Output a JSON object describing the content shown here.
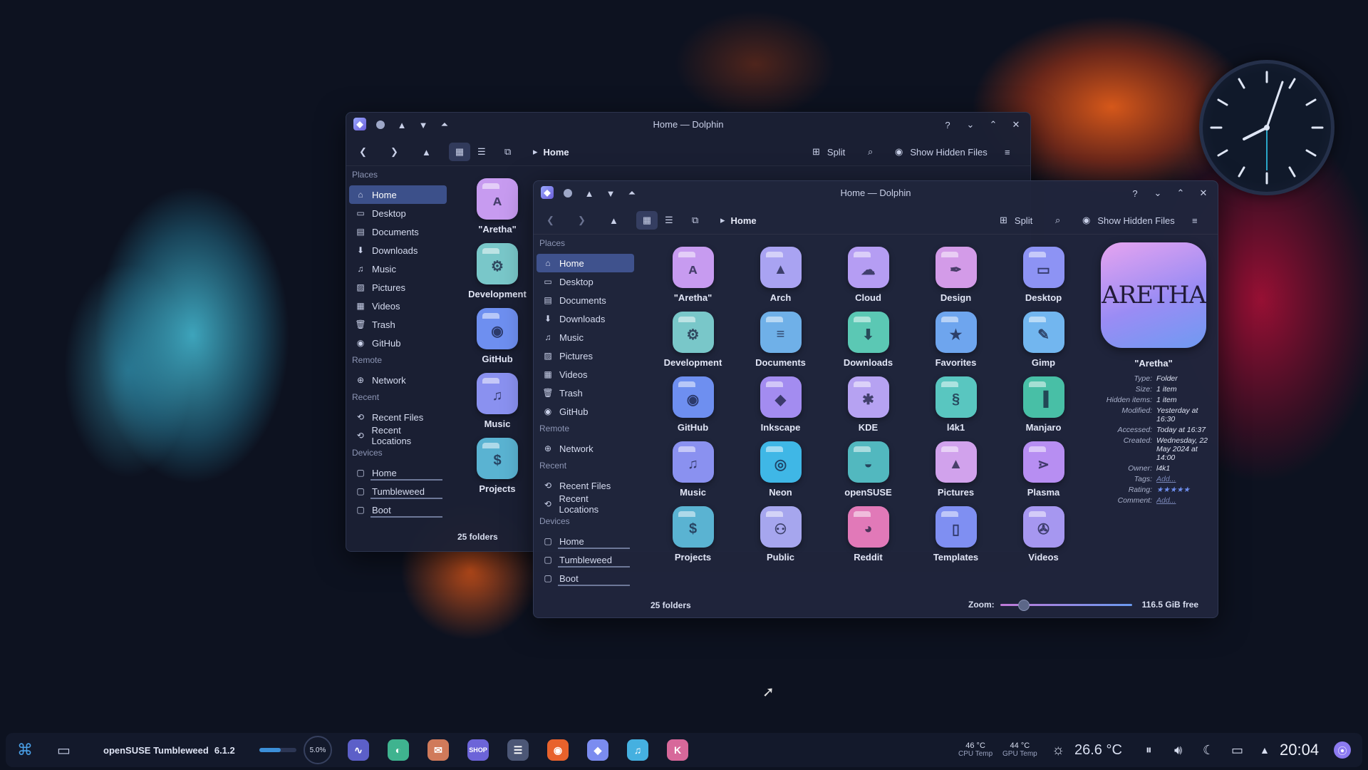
{
  "window_back": {
    "title": "Home — Dolphin",
    "breadcrumb": "Home",
    "split_label": "Split",
    "hidden_label": "Show Hidden Files",
    "status": "25 folders",
    "places_header": "Places",
    "places": [
      "Home",
      "Desktop",
      "Documents",
      "Downloads",
      "Music",
      "Pictures",
      "Videos",
      "Trash",
      "GitHub"
    ],
    "remote_header": "Remote",
    "remote": [
      "Network"
    ],
    "recent_header": "Recent",
    "recent": [
      "Recent Files",
      "Recent Locations"
    ],
    "devices_header": "Devices",
    "devices": [
      "Home",
      "Tumbleweed",
      "Boot"
    ],
    "folders": [
      "\"Aretha\"",
      "Development",
      "GitHub",
      "Music",
      "Projects"
    ]
  },
  "window_front": {
    "title": "Home — Dolphin",
    "breadcrumb": "Home",
    "split_label": "Split",
    "hidden_label": "Show Hidden Files",
    "places_header": "Places",
    "places": [
      "Home",
      "Desktop",
      "Documents",
      "Downloads",
      "Music",
      "Pictures",
      "Videos",
      "Trash",
      "GitHub"
    ],
    "remote_header": "Remote",
    "remote": [
      "Network"
    ],
    "recent_header": "Recent",
    "recent": [
      "Recent Files",
      "Recent Locations"
    ],
    "devices_header": "Devices",
    "devices": [
      "Home",
      "Tumbleweed",
      "Boot"
    ],
    "folders": [
      {
        "name": "\"Aretha\"",
        "icon": "aretha-logo",
        "symbol": "ᴀ",
        "color": "#c79bf0"
      },
      {
        "name": "Arch",
        "icon": "arch-icon",
        "symbol": "▲",
        "color": "#a9a3f2"
      },
      {
        "name": "Cloud",
        "icon": "cloud-icon",
        "symbol": "☁",
        "color": "#b59df3"
      },
      {
        "name": "Design",
        "icon": "pen-icon",
        "symbol": "✒",
        "color": "#d39be8"
      },
      {
        "name": "Desktop",
        "icon": "monitor-icon",
        "symbol": "▭",
        "color": "#8d93f4"
      },
      {
        "name": "Development",
        "icon": "gear-icon",
        "symbol": "⚙",
        "color": "#79c7c9"
      },
      {
        "name": "Documents",
        "icon": "document-icon",
        "symbol": "≡",
        "color": "#6fb0e8"
      },
      {
        "name": "Downloads",
        "icon": "download-icon",
        "symbol": "⬇",
        "color": "#5bc8b4"
      },
      {
        "name": "Favorites",
        "icon": "star-icon",
        "symbol": "★",
        "color": "#6ea5ee"
      },
      {
        "name": "Gimp",
        "icon": "gimp-icon",
        "symbol": "✎",
        "color": "#72b6ef"
      },
      {
        "name": "GitHub",
        "icon": "github-icon",
        "symbol": "◉",
        "color": "#6e8ff0"
      },
      {
        "name": "Inkscape",
        "icon": "inkscape-icon",
        "symbol": "◆",
        "color": "#a38cf0"
      },
      {
        "name": "KDE",
        "icon": "kde-icon",
        "symbol": "✱",
        "color": "#b6a2f2"
      },
      {
        "name": "l4k1",
        "icon": "dragon-icon",
        "symbol": "§",
        "color": "#59c6c0"
      },
      {
        "name": "Manjaro",
        "icon": "manjaro-icon",
        "symbol": "▐",
        "color": "#48bfa6"
      },
      {
        "name": "Music",
        "icon": "headphones-icon",
        "symbol": "♫",
        "color": "#8a91f0"
      },
      {
        "name": "Neon",
        "icon": "neon-icon",
        "symbol": "◎",
        "color": "#3fb7e6"
      },
      {
        "name": "openSUSE",
        "icon": "opensuse-icon",
        "symbol": "◒",
        "color": "#52b8bf"
      },
      {
        "name": "Pictures",
        "icon": "image-icon",
        "symbol": "▲",
        "color": "#d1a2ec"
      },
      {
        "name": "Plasma",
        "icon": "plasma-icon",
        "symbol": "⋗",
        "color": "#b78ef2"
      },
      {
        "name": "Projects",
        "icon": "dollar-icon",
        "symbol": "$",
        "color": "#5ab3d2"
      },
      {
        "name": "Public",
        "icon": "people-icon",
        "symbol": "⚇",
        "color": "#a6a6ee"
      },
      {
        "name": "Reddit",
        "icon": "reddit-icon",
        "symbol": "◕",
        "color": "#e179b8"
      },
      {
        "name": "Templates",
        "icon": "template-icon",
        "symbol": "▯",
        "color": "#7f8ff2"
      },
      {
        "name": "Videos",
        "icon": "film-icon",
        "symbol": "✇",
        "color": "#a697f0"
      }
    ],
    "status": "25 folders",
    "zoom_label": "Zoom:",
    "free_space": "116.5 GiB free",
    "info": {
      "logo_text": "ARETHA",
      "name": "\"Aretha\"",
      "rows": [
        {
          "k": "Type:",
          "v": "Folder"
        },
        {
          "k": "Size:",
          "v": "1 item"
        },
        {
          "k": "Hidden items:",
          "v": "1 item"
        },
        {
          "k": "Modified:",
          "v": "Yesterday at 16:30"
        },
        {
          "k": "Accessed:",
          "v": "Today at 16:37"
        },
        {
          "k": "Created:",
          "v": "Wednesday, 22 May 2024 at 14:00"
        },
        {
          "k": "Owner:",
          "v": "l4k1"
        },
        {
          "k": "Tags:",
          "v": "Add..."
        },
        {
          "k": "Rating:",
          "v": "★★★★★"
        },
        {
          "k": "Comment:",
          "v": "Add..."
        }
      ]
    }
  },
  "taskbar": {
    "distro": "openSUSE Tumbleweed",
    "version": "6.1.2",
    "cpu_usage": "5.0%",
    "cpu_temp": "46 °C",
    "cpu_temp_label": "CPU Temp",
    "gpu_temp": "44 °C",
    "gpu_temp_label": "GPU Temp",
    "weather_temp": "26.6 °C",
    "time": "20:04"
  }
}
